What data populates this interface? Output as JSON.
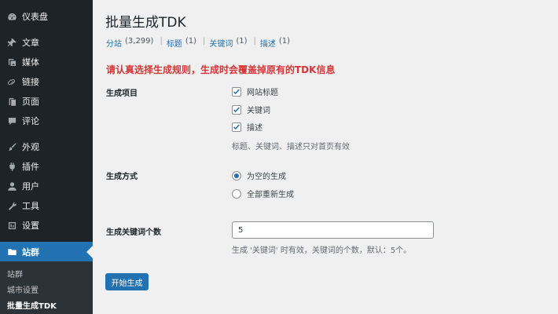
{
  "sidebar": {
    "items": [
      {
        "label": "仪表盘",
        "icon": "dashboard-icon"
      },
      {
        "label": "文章",
        "icon": "pin-icon"
      },
      {
        "label": "媒体",
        "icon": "media-icon"
      },
      {
        "label": "链接",
        "icon": "link-icon"
      },
      {
        "label": "页面",
        "icon": "page-icon"
      },
      {
        "label": "评论",
        "icon": "comment-icon"
      },
      {
        "label": "外观",
        "icon": "brush-icon"
      },
      {
        "label": "插件",
        "icon": "plugin-icon"
      },
      {
        "label": "用户",
        "icon": "user-icon"
      },
      {
        "label": "工具",
        "icon": "wrench-icon"
      },
      {
        "label": "设置",
        "icon": "settings-icon"
      },
      {
        "label": "站群",
        "icon": "folder-icon"
      }
    ],
    "submenu": [
      "站群",
      "城市设置",
      "批量生成TDK"
    ]
  },
  "main": {
    "title": "批量生成TDK",
    "filters": [
      {
        "label": "分站",
        "count": "(3,299)"
      },
      {
        "label": "标题",
        "count": "(1)"
      },
      {
        "label": "关键词",
        "count": "(1)"
      },
      {
        "label": "描述",
        "count": "(1)"
      }
    ],
    "filter_separator": "|",
    "warning": "请认真选择生成规则，生成时会覆盖掉原有的TDK信息",
    "items_label": "生成项目",
    "items": [
      {
        "label": "网站标题",
        "checked": true
      },
      {
        "label": "关键词",
        "checked": true
      },
      {
        "label": "描述",
        "checked": true
      }
    ],
    "items_desc": "标题、关键词、描述只对首页有效",
    "mode_label": "生成方式",
    "modes": [
      {
        "label": "为空的生成",
        "selected": true
      },
      {
        "label": "全部重新生成",
        "selected": false
      }
    ],
    "keyword_count_label": "生成关键词个数",
    "keyword_count_value": "5",
    "keyword_count_desc": "生成 '关键词' 时有效，关键词的个数，默认：5个。",
    "submit_label": "开始生成"
  },
  "colors": {
    "sidebar_bg": "#1d2327",
    "accent": "#2271b1",
    "warning": "#d63638"
  }
}
